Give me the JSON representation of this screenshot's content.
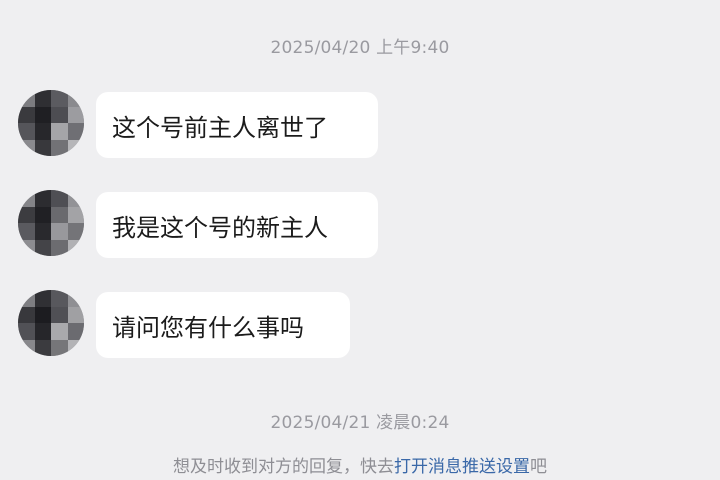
{
  "chat": {
    "timestamp_1": "2025/04/20 上午9:40",
    "timestamp_2": "2025/04/21 凌晨0:24",
    "messages": [
      {
        "text": "这个号前主人离世了"
      },
      {
        "text": "我是这个号的新主人"
      },
      {
        "text": "请问您有什么事吗"
      }
    ]
  },
  "notice": {
    "prefix": "想及时收到对方的回复，快去",
    "link": "打开消息推送设置",
    "suffix": "吧"
  },
  "colors": {
    "background": "#efeff1",
    "bubble": "#ffffff",
    "timestamp_text": "#9a9aa0",
    "link": "#3a68a8"
  }
}
